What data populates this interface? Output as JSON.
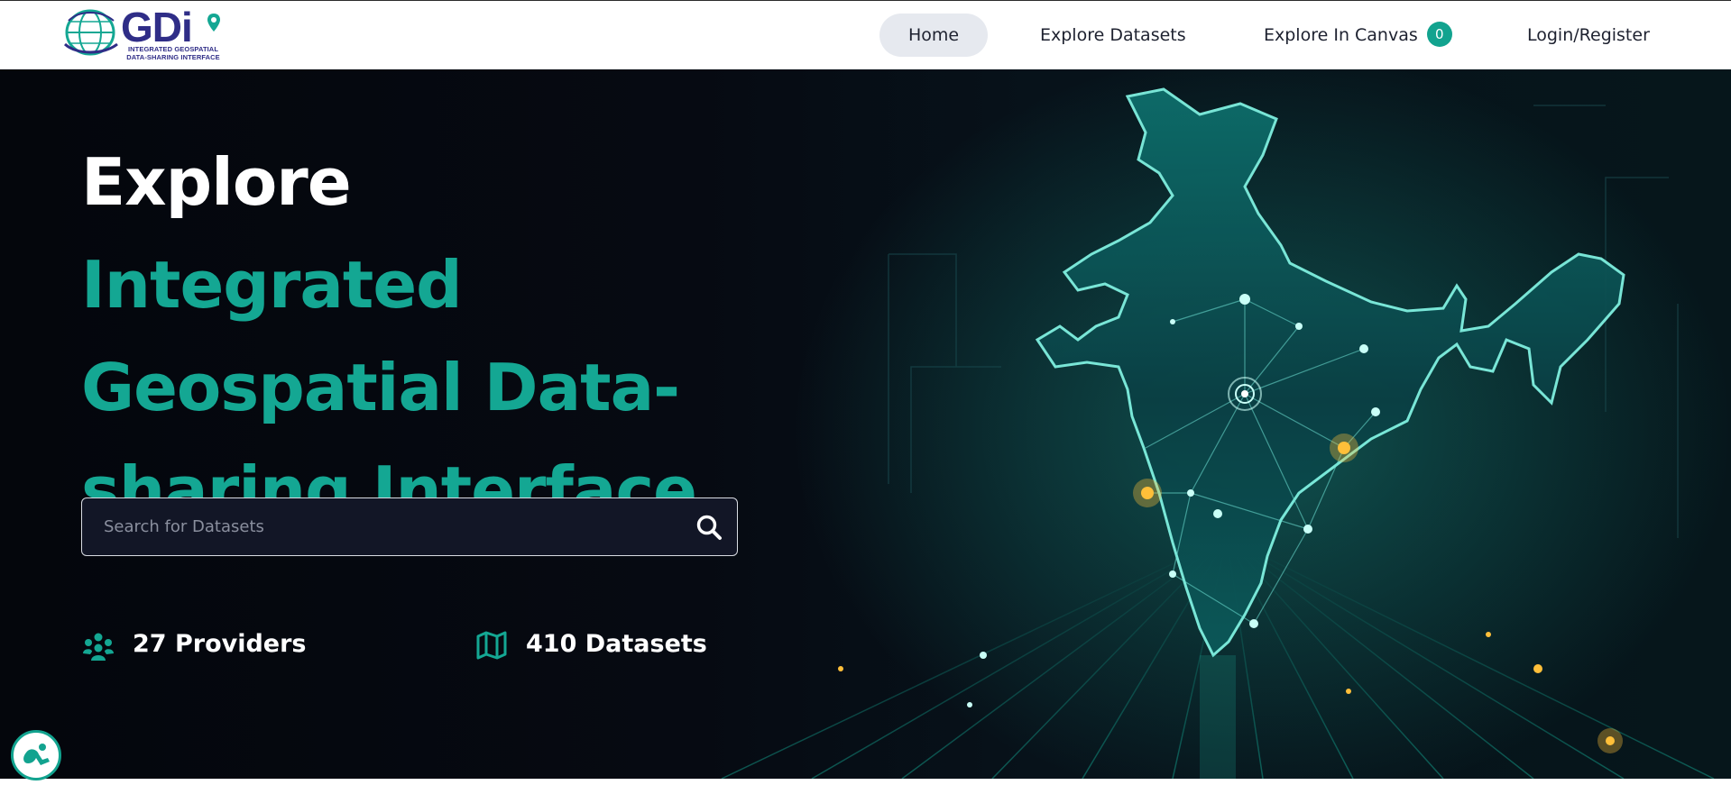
{
  "header": {
    "logo": {
      "text": "GDi",
      "subtitle_line1": "INTEGRATED GEOSPATIAL",
      "subtitle_line2": "DATA-SHARING INTERFACE"
    },
    "nav": {
      "home": "Home",
      "explore_datasets": "Explore Datasets",
      "explore_in_canvas": "Explore In Canvas",
      "canvas_count": "0",
      "login": "Login/Register"
    }
  },
  "hero": {
    "title_white": "Explore ",
    "title_teal": "Integrated Geospatial Data-sharing Interface",
    "search": {
      "placeholder": "Search for Datasets",
      "value": ""
    },
    "stats": {
      "providers": "27 Providers",
      "datasets": "410 Datasets"
    }
  },
  "icons": {
    "search": "search-icon",
    "providers": "users-group-icon",
    "datasets": "map-icon",
    "assistant": "accessibility-icon"
  },
  "colors": {
    "accent": "#14a793",
    "brand": "#2f2d87",
    "hero_bg": "#05080e",
    "nav_active_bg": "#e6e9ef"
  }
}
